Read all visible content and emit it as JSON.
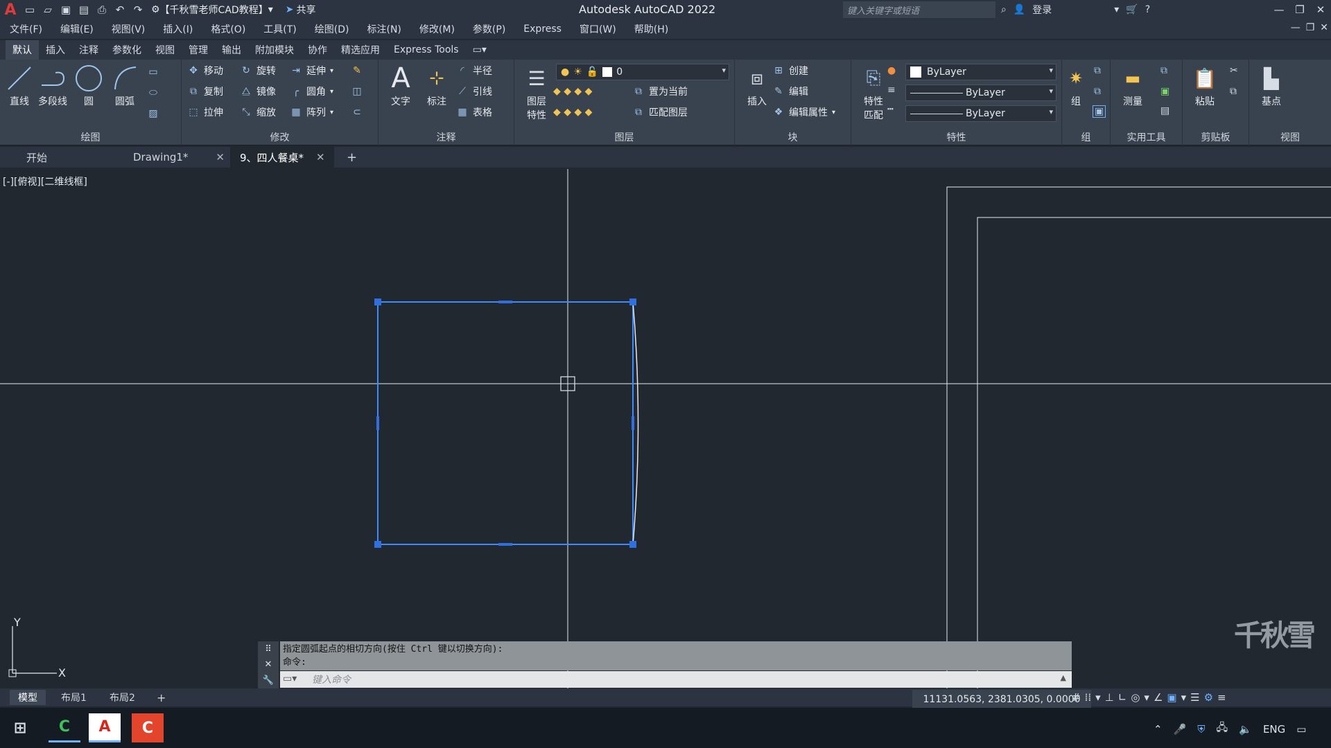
{
  "titlebar": {
    "app_title": "Autodesk AutoCAD 2022",
    "workspace": "【千秋雪老师CAD教程】",
    "share_label": "共享",
    "search_placeholder": "键入关键字或短语",
    "login_label": "登录"
  },
  "menubar": [
    "文件(F)",
    "编辑(E)",
    "视图(V)",
    "插入(I)",
    "格式(O)",
    "工具(T)",
    "绘图(D)",
    "标注(N)",
    "修改(M)",
    "参数(P)",
    "Express",
    "窗口(W)",
    "帮助(H)"
  ],
  "ribbon_tabs": [
    "默认",
    "插入",
    "注释",
    "参数化",
    "视图",
    "管理",
    "输出",
    "附加模块",
    "协作",
    "精选应用",
    "Express Tools"
  ],
  "ribbon": {
    "draw": {
      "title": "绘图",
      "line": "直线",
      "polyline": "多段线",
      "circle": "圆",
      "arc": "圆弧"
    },
    "modify": {
      "title": "修改",
      "move": "移动",
      "rotate": "旋转",
      "extend": "延伸",
      "copy": "复制",
      "mirror": "镜像",
      "fillet": "圆角",
      "stretch": "拉伸",
      "scale": "缩放",
      "array": "阵列"
    },
    "annotation": {
      "title": "注释",
      "text": "文字",
      "dimension": "标注",
      "radius": "半径",
      "leader": "引线",
      "table": "表格"
    },
    "layers": {
      "title": "图层",
      "layer_props_1": "图层",
      "layer_props_2": "特性",
      "current_layer": "0",
      "set_current": "置为当前",
      "match_layer": "匹配图层"
    },
    "block": {
      "title": "块",
      "insert": "插入",
      "create": "创建",
      "edit": "编辑",
      "edit_attr": "编辑属性"
    },
    "properties": {
      "title": "特性",
      "match_1": "特性",
      "match_2": "匹配",
      "color": "ByLayer",
      "lineweight": "ByLayer",
      "linetype": "ByLayer"
    },
    "groups": {
      "title": "组",
      "group": "组"
    },
    "utilities": {
      "title": "实用工具",
      "measure": "测量"
    },
    "clipboard": {
      "title": "剪贴板",
      "paste": "粘贴"
    },
    "view": {
      "title": "视图",
      "base": "基点"
    }
  },
  "file_tabs": [
    {
      "label": "开始"
    },
    {
      "label": "Drawing1*"
    },
    {
      "label": "9、四人餐桌*"
    }
  ],
  "viewport_label": "[-][俯视][二维线框]",
  "command": {
    "history_1": "指定圆弧起点的相切方向(按住 Ctrl 键以切换方向):",
    "history_2": "命令:",
    "input_placeholder": "键入命令"
  },
  "layout_tabs": [
    "模型",
    "布局1",
    "布局2"
  ],
  "status": {
    "coords": "11131.0563, 2381.0305, 0.0000",
    "lang": "ENG"
  },
  "ucs": {
    "x": "X",
    "y": "Y"
  },
  "watermark": "千秋雪",
  "colors": {
    "selection": "#3d8bff",
    "grip": "#2f6fe0",
    "background": "#212830",
    "ribbon": "#39424f"
  }
}
